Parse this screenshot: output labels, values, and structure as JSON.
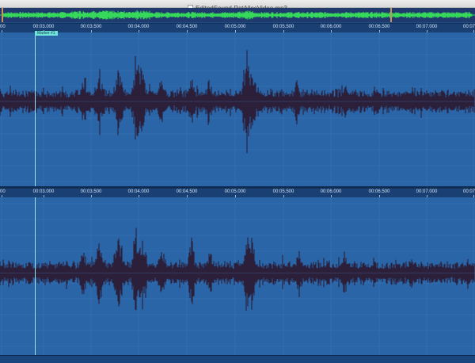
{
  "window": {
    "title": "EditedSound-PatAllesVideo.mp3"
  },
  "ruler": {
    "labels": [
      "00",
      "00:03.000",
      "00:03.500",
      "00:04.000",
      "00:04.500",
      "00:05.000",
      "00:05.500",
      "00:06.000",
      "00:06.500",
      "00:07.000",
      "00:07"
    ],
    "labels_lower": [
      "00",
      "00:03.000",
      "00:03.500",
      "00:04.000",
      "00:04.500",
      "00:05.000",
      "00:05.500",
      "00:06.000",
      "00:06.500",
      "00:07.000",
      "00:07"
    ]
  },
  "marker": {
    "label": "Marker #1"
  },
  "colors": {
    "background": "#1d4f86",
    "track": "#2a65a8",
    "waveform": "#2b1f3a",
    "overview_wave": "#37d95a",
    "selection_handle": "#c9935a",
    "gridline": "#3f7cc0",
    "marker": "#6fe3d9"
  }
}
